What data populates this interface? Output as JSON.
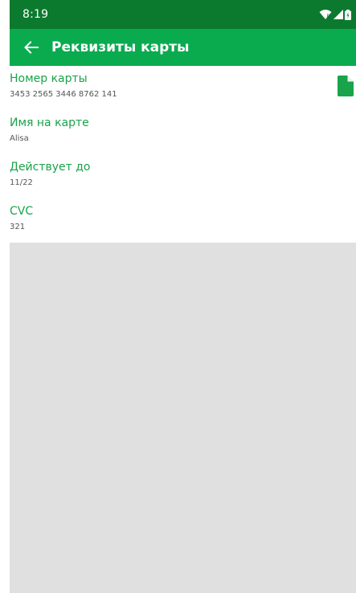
{
  "status_bar": {
    "time": "8:19"
  },
  "app_bar": {
    "title": "Реквизиты карты"
  },
  "fields": [
    {
      "label": "Номер карты",
      "value": "3453 2565 3446 8762 141"
    },
    {
      "label": "Имя на карте",
      "value": "Alisa"
    },
    {
      "label": "Действует до",
      "value": "11/22"
    },
    {
      "label": "CVC",
      "value": "321"
    }
  ],
  "colors": {
    "status_bar": "#0b7a2e",
    "app_bar": "#0aab4f",
    "accent": "#19a34a",
    "background": "#e0e0e0"
  },
  "icons": {
    "back": "arrow-back-icon",
    "copy": "copy-icon",
    "wifi": "wifi-icon",
    "signal": "signal-icon",
    "battery": "battery-icon"
  }
}
